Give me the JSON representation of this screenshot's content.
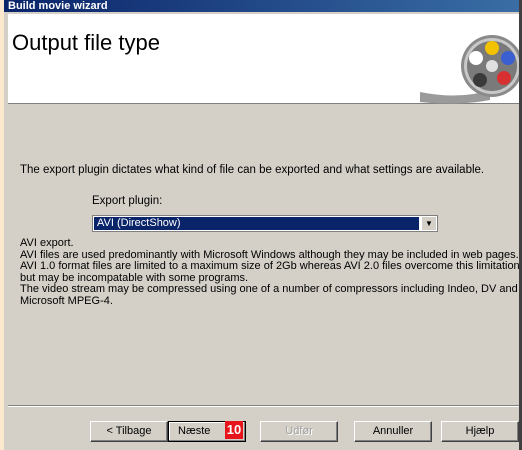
{
  "window": {
    "title": "Build movie wizard"
  },
  "header": {
    "title": "Output file type",
    "logo_icon": "film-reel-icon"
  },
  "body": {
    "description": "The export plugin dictates what kind of file can be exported and what settings are available.",
    "plugin_label": "Export plugin:",
    "plugin_value": "AVI (DirectShow)",
    "info_lines": [
      "AVI export.",
      "AVI files are used predominantly with Microsoft Windows although they may be included in web pages. AVI 1.0 format files are limited to a maximum size of 2Gb whereas AVI 2.0 files overcome this limitation but may be incompatable with some programs.",
      "The video stream may be compressed using one of a number of compressors including Indeo, DV and Microsoft MPEG-4."
    ]
  },
  "buttons": {
    "back": "< Tilbage",
    "next": "Næste",
    "finish": "Udfør",
    "cancel": "Annuller",
    "help": "Hjælp"
  },
  "badge": "10",
  "colors": {
    "selection": "#0a246a",
    "badge": "#e8141b",
    "dialog": "#d4d0c8"
  }
}
